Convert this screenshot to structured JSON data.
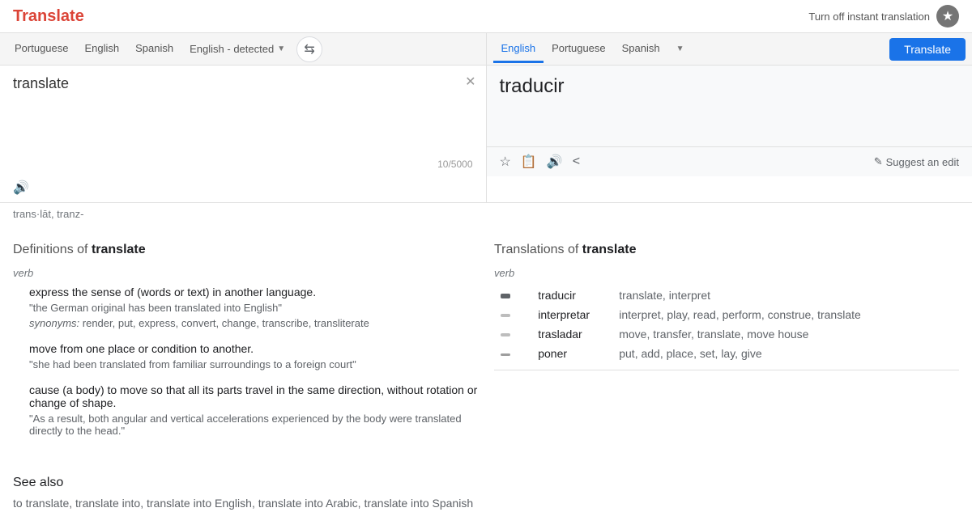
{
  "app": {
    "title": "Translate",
    "top_right_text": "Turn off instant translation"
  },
  "source_lang_tabs": [
    {
      "label": "Portuguese",
      "active": false
    },
    {
      "label": "English",
      "active": false
    },
    {
      "label": "Spanish",
      "active": false
    },
    {
      "label": "English - detected",
      "active": true,
      "hasDropdown": true
    }
  ],
  "target_lang_tabs": [
    {
      "label": "English",
      "active": true
    },
    {
      "label": "Portuguese",
      "active": false
    },
    {
      "label": "Spanish",
      "active": false
    }
  ],
  "translate_button_label": "Translate",
  "source_text": "translate",
  "char_count": "10/5000",
  "translated_text": "traducir",
  "phonetic": "trans·lāt, tranz-",
  "suggest_edit_label": "Suggest an edit",
  "definitions_title": "Definitions of",
  "definitions_word": "translate",
  "definitions_pos": "verb",
  "definitions": [
    {
      "text": "express the sense of (words or text) in another language.",
      "example": "\"the German original has been translated into English\"",
      "synonyms": "render, put, express, convert, change, transcribe, transliterate"
    },
    {
      "text": "move from one place or condition to another.",
      "example": "\"she had been translated from familiar surroundings to a foreign court\""
    },
    {
      "text": "cause (a body) to move so that all its parts travel in the same direction, without rotation or change of shape.",
      "example": "\"As a result, both angular and vertical accelerations experienced by the body were translated directly to the head.\""
    }
  ],
  "translations_title": "Translations of",
  "translations_word": "translate",
  "translations_pos": "verb",
  "translation_rows": [
    {
      "word": "traducir",
      "meanings": "translate, interpret",
      "weight": "bold"
    },
    {
      "word": "interpretar",
      "meanings": "interpret, play, read, perform, construe, translate",
      "weight": "medium"
    },
    {
      "word": "trasladar",
      "meanings": "move, transfer, translate, move house",
      "weight": "medium"
    },
    {
      "word": "poner",
      "meanings": "put, add, place, set, lay, give",
      "weight": "light"
    }
  ],
  "see_also": {
    "title": "See also",
    "links": "to translate, translate into, translate into English, translate into Arabic, translate into Spanish"
  }
}
